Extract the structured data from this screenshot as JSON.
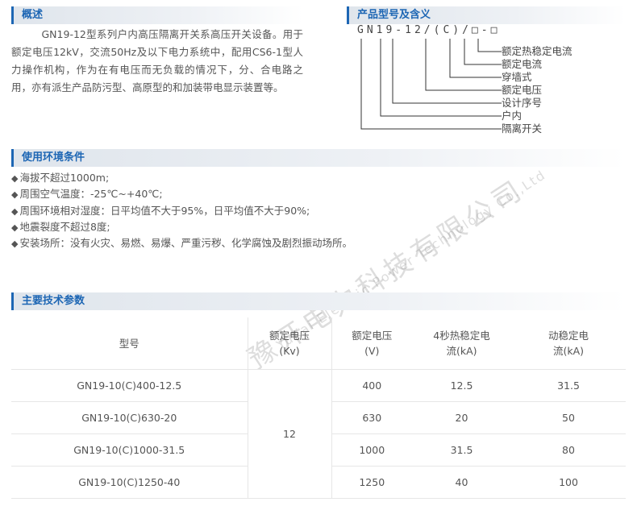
{
  "overview": {
    "heading": "概述",
    "paragraph": "GN19-12型系列户内高压隔离开关系高压开关设备。用于额定电压12kV，交流50Hz及以下电力系统中，配用CS6-1型人力操作机构，作为在有电压而无负载的情况下，分、合电路之用，亦有派生产品防污型、高原型的和加装带电显示装置等。"
  },
  "model_meaning": {
    "heading": "产品型号及含义",
    "code": "GN19-12/(C)/□-□",
    "labels": [
      "额定热稳定电流",
      "额定电流",
      "穿墙式",
      "额定电压",
      "设计序号",
      "户内",
      "隔离开关"
    ]
  },
  "environment": {
    "heading": "使用环境条件",
    "items": [
      "海拔不超过1000m;",
      "周围空气温度：-25℃~+40℃;",
      "周围环境相对湿度：日平均值不大于95%，日平均值不大于90%;",
      "地震裂度不超过8度;",
      "安装场所：没有火灾、易燃、易爆、严重污秽、化学腐蚀及剧烈振动场所。"
    ]
  },
  "watermark": {
    "cn": "豫开电力科技有限公司",
    "en": "YuKai Electric Power Technology Co.,Ltd"
  },
  "specs": {
    "heading": "主要技术参数",
    "headers": [
      "型号",
      "额定电压(Kv)",
      "额定电压(V)",
      "4秒热稳定电流(kA)",
      "动稳定电流(kA)"
    ],
    "rated_voltage_kv": "12",
    "rows": [
      {
        "model": "GN19-10(C)400-12.5",
        "rated_v": "400",
        "thermal": "12.5",
        "dynamic": "31.5"
      },
      {
        "model": "GN19-10(C)630-20",
        "rated_v": "630",
        "thermal": "20",
        "dynamic": "50"
      },
      {
        "model": "GN19-10(C)1000-31.5",
        "rated_v": "1000",
        "thermal": "31.5",
        "dynamic": "80"
      },
      {
        "model": "GN19-10(C)1250-40",
        "rated_v": "1250",
        "thermal": "40",
        "dynamic": "100"
      }
    ]
  }
}
